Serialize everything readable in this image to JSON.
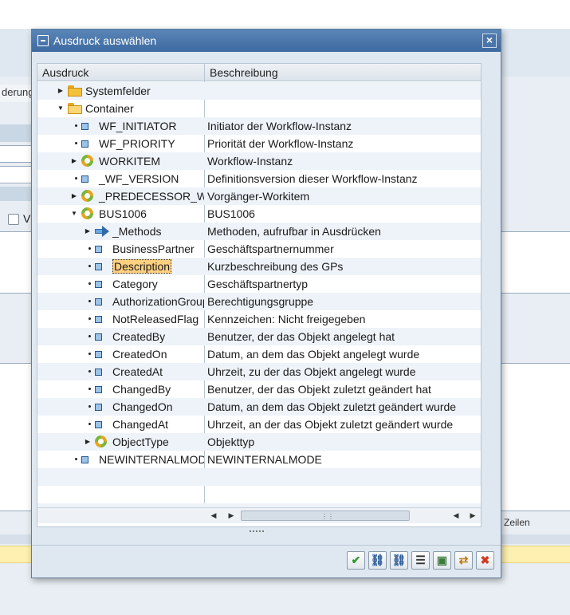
{
  "background": {
    "left_label": "derung",
    "checkbox_label": "V",
    "right_text": "Zeilen"
  },
  "dialog": {
    "title": "Ausdruck auswählen",
    "close_label": "×"
  },
  "tree": {
    "columns": [
      "Ausdruck",
      "Beschreibung"
    ],
    "rows": [
      {
        "label": "Systemfelder",
        "desc": "",
        "level": 0,
        "expander": "collapsed",
        "icon": "folder-closed-icon",
        "bullet": false
      },
      {
        "label": "Container",
        "desc": "",
        "level": 0,
        "expander": "expanded",
        "icon": "folder-open-icon",
        "bullet": false
      },
      {
        "label": "WF_INITIATOR",
        "desc": "Initiator der Workflow-Instanz",
        "level": 1,
        "expander": "none",
        "icon": "attribute-icon",
        "bullet": true
      },
      {
        "label": "WF_PRIORITY",
        "desc": "Priorität der Workflow-Instanz",
        "level": 1,
        "expander": "none",
        "icon": "attribute-icon",
        "bullet": true
      },
      {
        "label": "WORKITEM",
        "desc": "Workflow-Instanz",
        "level": 1,
        "expander": "collapsed",
        "icon": "object-icon",
        "bullet": false
      },
      {
        "label": "_WF_VERSION",
        "desc": "Definitionsversion dieser Workflow-Instanz",
        "level": 1,
        "expander": "none",
        "icon": "attribute-icon",
        "bullet": true
      },
      {
        "label": "_PREDECESSOR_WI",
        "desc": "Vorgänger-Workitem",
        "level": 1,
        "expander": "collapsed",
        "icon": "object-icon",
        "bullet": false
      },
      {
        "label": "BUS1006",
        "desc": "BUS1006",
        "level": 1,
        "expander": "expanded",
        "icon": "object-icon",
        "bullet": false
      },
      {
        "label": "_Methods",
        "desc": "Methoden, aufrufbar in Ausdrücken",
        "level": 2,
        "expander": "collapsed",
        "icon": "method-arrow-icon",
        "bullet": false
      },
      {
        "label": "BusinessPartner",
        "desc": "Geschäftspartnernummer",
        "level": 2,
        "expander": "none",
        "icon": "attribute-icon",
        "bullet": true
      },
      {
        "label": "Description",
        "desc": "Kurzbeschreibung des GPs",
        "level": 2,
        "expander": "none",
        "icon": "attribute-icon",
        "bullet": true,
        "selected": true
      },
      {
        "label": "Category",
        "desc": "Geschäftspartnertyp",
        "level": 2,
        "expander": "none",
        "icon": "attribute-icon",
        "bullet": true
      },
      {
        "label": "AuthorizationGroup",
        "desc": "Berechtigungsgruppe",
        "level": 2,
        "expander": "none",
        "icon": "attribute-icon",
        "bullet": true
      },
      {
        "label": "NotReleasedFlag",
        "desc": "Kennzeichen: Nicht freigegeben",
        "level": 2,
        "expander": "none",
        "icon": "attribute-icon",
        "bullet": true
      },
      {
        "label": "CreatedBy",
        "desc": "Benutzer, der das Objekt angelegt hat",
        "level": 2,
        "expander": "none",
        "icon": "attribute-icon",
        "bullet": true
      },
      {
        "label": "CreatedOn",
        "desc": "Datum, an dem das Objekt angelegt wurde",
        "level": 2,
        "expander": "none",
        "icon": "attribute-icon",
        "bullet": true
      },
      {
        "label": "CreatedAt",
        "desc": "Uhrzeit, zu der das Objekt angelegt wurde",
        "level": 2,
        "expander": "none",
        "icon": "attribute-icon",
        "bullet": true
      },
      {
        "label": "ChangedBy",
        "desc": "Benutzer, der das Objekt zuletzt geändert hat",
        "level": 2,
        "expander": "none",
        "icon": "attribute-icon",
        "bullet": true
      },
      {
        "label": "ChangedOn",
        "desc": "Datum, an dem das Objekt zuletzt geändert wurde",
        "level": 2,
        "expander": "none",
        "icon": "attribute-icon",
        "bullet": true
      },
      {
        "label": "ChangedAt",
        "desc": "Uhrzeit, an der das Objekt zuletzt geändert wurde",
        "level": 2,
        "expander": "none",
        "icon": "attribute-icon",
        "bullet": true
      },
      {
        "label": "ObjectType",
        "desc": "Objekttyp",
        "level": 2,
        "expander": "collapsed",
        "icon": "object-icon",
        "bullet": false
      },
      {
        "label": "NEWINTERNALMODE",
        "desc": "NEWINTERNALMODE",
        "level": 1,
        "expander": "none",
        "icon": "attribute-icon",
        "bullet": true
      }
    ]
  },
  "toolbar": {
    "buttons": [
      {
        "name": "confirm-button",
        "icon": "checkmark-icon",
        "glyph": "✔",
        "color": "#2e9a2e"
      },
      {
        "name": "find-button",
        "icon": "binoculars-icon",
        "glyph": "⛓",
        "color": "#2f5f9a"
      },
      {
        "name": "find-next-button",
        "icon": "binoculars-plus-icon",
        "glyph": "⛓",
        "color": "#2f5f9a"
      },
      {
        "name": "list-button",
        "icon": "list-icon",
        "glyph": "☰",
        "color": "#333333"
      },
      {
        "name": "object-button",
        "icon": "object-tree-icon",
        "glyph": "▣",
        "color": "#3d7a3d"
      },
      {
        "name": "transfer-button",
        "icon": "transfer-icon",
        "glyph": "⇄",
        "color": "#c07a12"
      },
      {
        "name": "cancel-button",
        "icon": "cancel-icon",
        "glyph": "✖",
        "color": "#d23b1f"
      }
    ]
  }
}
